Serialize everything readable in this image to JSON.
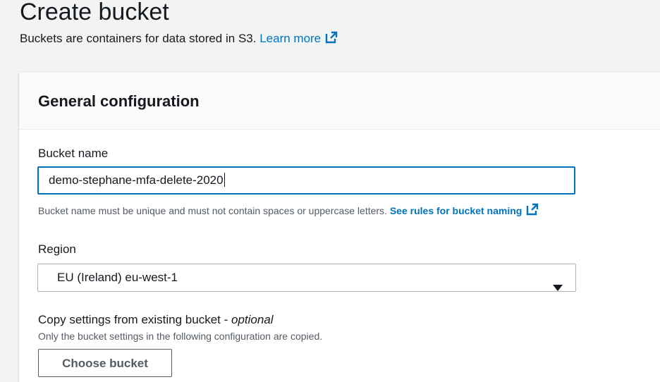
{
  "page": {
    "title": "Create bucket",
    "description": "Buckets are containers for data stored in S3.",
    "learn_more_link": "Learn more"
  },
  "general_configuration": {
    "title": "General configuration",
    "bucket_name": {
      "label": "Bucket name",
      "value": "demo-stephane-mfa-delete-2020",
      "hint": "Bucket name must be unique and must not contain spaces or uppercase letters.",
      "rules_link": "See rules for bucket naming"
    },
    "region": {
      "label": "Region",
      "selected": "EU (Ireland) eu-west-1"
    },
    "copy_settings": {
      "label": "Copy settings from existing bucket -",
      "optional": "optional",
      "description": "Only the bucket settings in the following configuration are copied.",
      "button_label": "Choose bucket"
    }
  },
  "icons": {
    "external_link": "external-link-icon",
    "dropdown_caret": "caret-down-icon"
  },
  "colors": {
    "link": "#0073bb",
    "focus_border": "#0073bb",
    "background": "#f2f3f3",
    "panel_header": "#fafafa"
  }
}
